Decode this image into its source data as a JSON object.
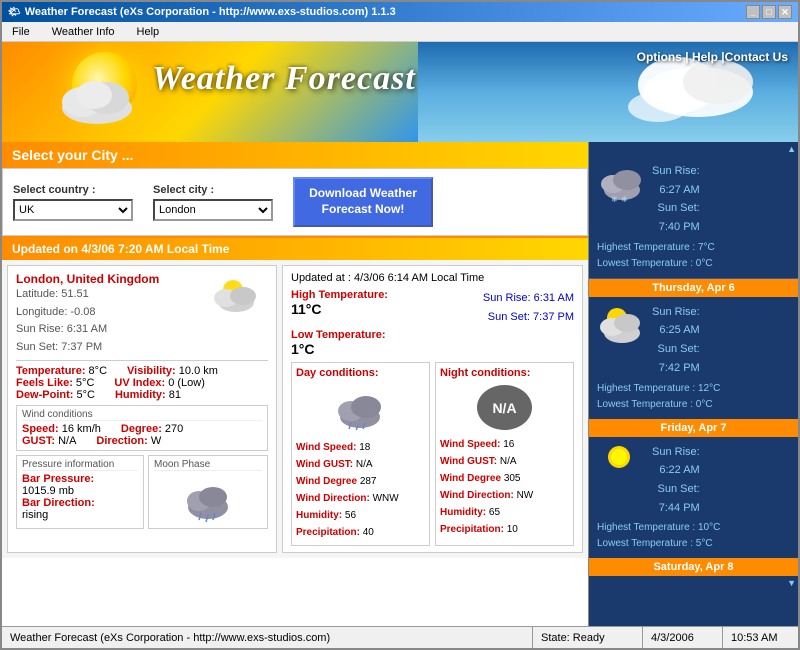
{
  "window": {
    "title": "Weather Forecast (eXs Corporation - http://www.exs-studios.com) 1.1.3",
    "title_short": "Weather Forecast (eXs Corporation - http://www.exs-studios.com) 1.1.3"
  },
  "menu": {
    "items": [
      "File",
      "Weather Info",
      "Help"
    ]
  },
  "header": {
    "title": "Weather Forecast",
    "nav": "Options  |  Help  |Contact Us"
  },
  "select_section": {
    "header": "Select your City ...",
    "country_label": "Select country :",
    "country_value": "UK",
    "city_label": "Select city :",
    "city_value": "London",
    "download_btn": "Download Weather Forecast Now!"
  },
  "update_bar": {
    "text": "Updated on 4/3/06  7:20 AM Local Time"
  },
  "city_info": {
    "name": "London, United Kingdom",
    "latitude": "Latitude:  51.51",
    "longitude": "Longitude:  -0.08",
    "sun_rise": "Sun Rise:  6:31 AM",
    "sun_set": "Sun Set:  7:37 PM"
  },
  "metrics": {
    "temperature": "8°C",
    "feels_like": "5°C",
    "dew_point": "5°C",
    "visibility": "10.0 km",
    "uv_index": "0 (Low)",
    "humidity": "81"
  },
  "wind": {
    "speed": "16 km/h",
    "gust": "N/A",
    "degree": "270",
    "direction": "W"
  },
  "pressure": {
    "bar_pressure": "1015.9 mb",
    "bar_direction": "rising"
  },
  "detail": {
    "updated_at": "Updated at :   4/3/06  6:14 AM Local Time",
    "high_temp_label": "High Temperature:",
    "high_temp": "11°C",
    "low_temp_label": "Low Temperature:",
    "low_temp": "1°C",
    "sun_rise_label": "Sun Rise:",
    "sun_rise": "6:31 AM",
    "sun_set_label": "Sun Set:",
    "sun_set": "7:37 PM",
    "day_conditions_label": "Day conditions:",
    "night_conditions_label": "Night conditions:",
    "day_wind_speed_label": "Wind Speed:",
    "day_wind_speed": "18",
    "day_wind_gust_label": "Wind GUST:",
    "day_wind_gust": "N/A",
    "day_wind_degree_label": "Wind Degree",
    "day_wind_degree": "287",
    "day_wind_direction_label": "Wind Direction:",
    "day_wind_direction": "WNW",
    "day_humidity_label": "Humidity:",
    "day_humidity": "56",
    "day_precipitation_label": "Precipitation:",
    "day_precipitation": "40",
    "night_wind_speed": "16",
    "night_wind_gust": "N/A",
    "night_wind_degree": "305",
    "night_wind_direction": "NW",
    "night_humidity": "65",
    "night_precipitation": "10"
  },
  "right_panel": {
    "today": {
      "sun_rise": "6:27 AM",
      "sun_set": "7:40 PM",
      "high_temp": "Highest Temperature :  7°C",
      "low_temp": "Lowest Temperature :  0°C"
    },
    "forecasts": [
      {
        "day": "Thursday, Apr 6",
        "sun_rise": "6:25 AM",
        "sun_set": "7:42 PM",
        "high_temp": "Highest Temperature :  12°C",
        "low_temp": "Lowest Temperature :  0°C"
      },
      {
        "day": "Friday, Apr 7",
        "sun_rise": "6:22 AM",
        "sun_set": "7:44 PM",
        "high_temp": "Highest Temperature :  10°C",
        "low_temp": "Lowest Temperature :  5°C"
      },
      {
        "day": "Saturday, Apr 8",
        "sun_rise": "",
        "sun_set": "",
        "high_temp": "",
        "low_temp": ""
      }
    ]
  },
  "status_bar": {
    "main": "Weather Forecast (eXs Corporation - http://www.exs-studios.com)",
    "state": "State: Ready",
    "date": "4/3/2006",
    "time": "10:53 AM"
  },
  "moon_phase": {
    "label": "Moon Phase"
  }
}
